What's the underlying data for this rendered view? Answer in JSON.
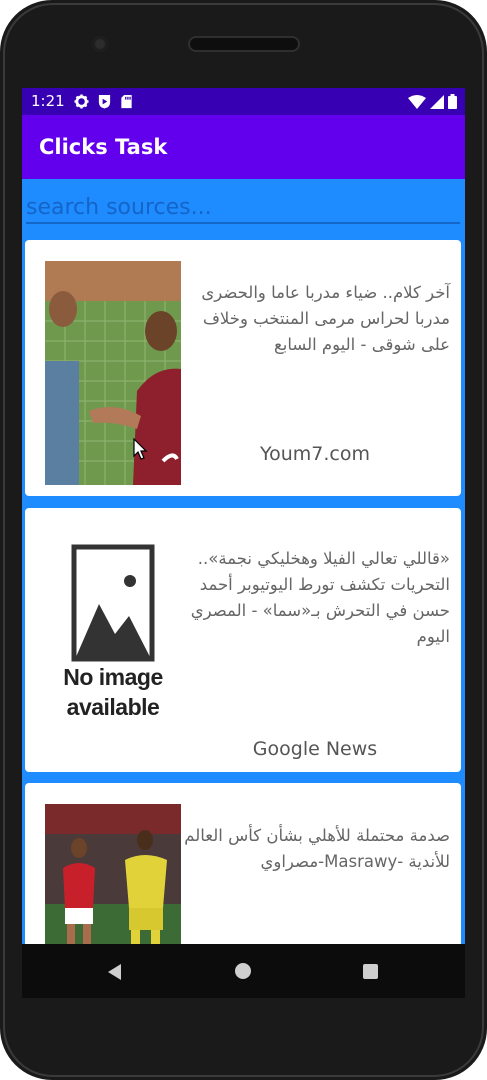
{
  "status_bar": {
    "time": "1:21"
  },
  "app_bar": {
    "title": "Clicks Task"
  },
  "search": {
    "placeholder": "search sources..."
  },
  "articles": [
    {
      "headline": "آخر كلام.. ضياء مدربا عاما والحضرى مدربا لحراس مرمى المنتخب وخلاف على شوقى - اليوم السابع",
      "source": "Youm7.com",
      "image": "photo-two-men"
    },
    {
      "headline": "«قاللي تعالي الفيلا وهخليكي نجمة».. التحريات تكشف تورط اليوتيوبر أحمد حسن في التحرش بـ«سما» - المصري اليوم",
      "source": "Google News",
      "image": "no-image",
      "no_image_text": [
        "No image",
        "available"
      ]
    },
    {
      "headline": "صدمة محتملة للأهلي بشأن كأس العالم للأندية -Masrawy-مصراوي",
      "source": "",
      "image": "photo-football-players"
    }
  ],
  "colors": {
    "status_bar": "#3700b3",
    "app_bar": "#6200ee",
    "list_background": "#1e8bff",
    "search_text": "#1565c8"
  }
}
